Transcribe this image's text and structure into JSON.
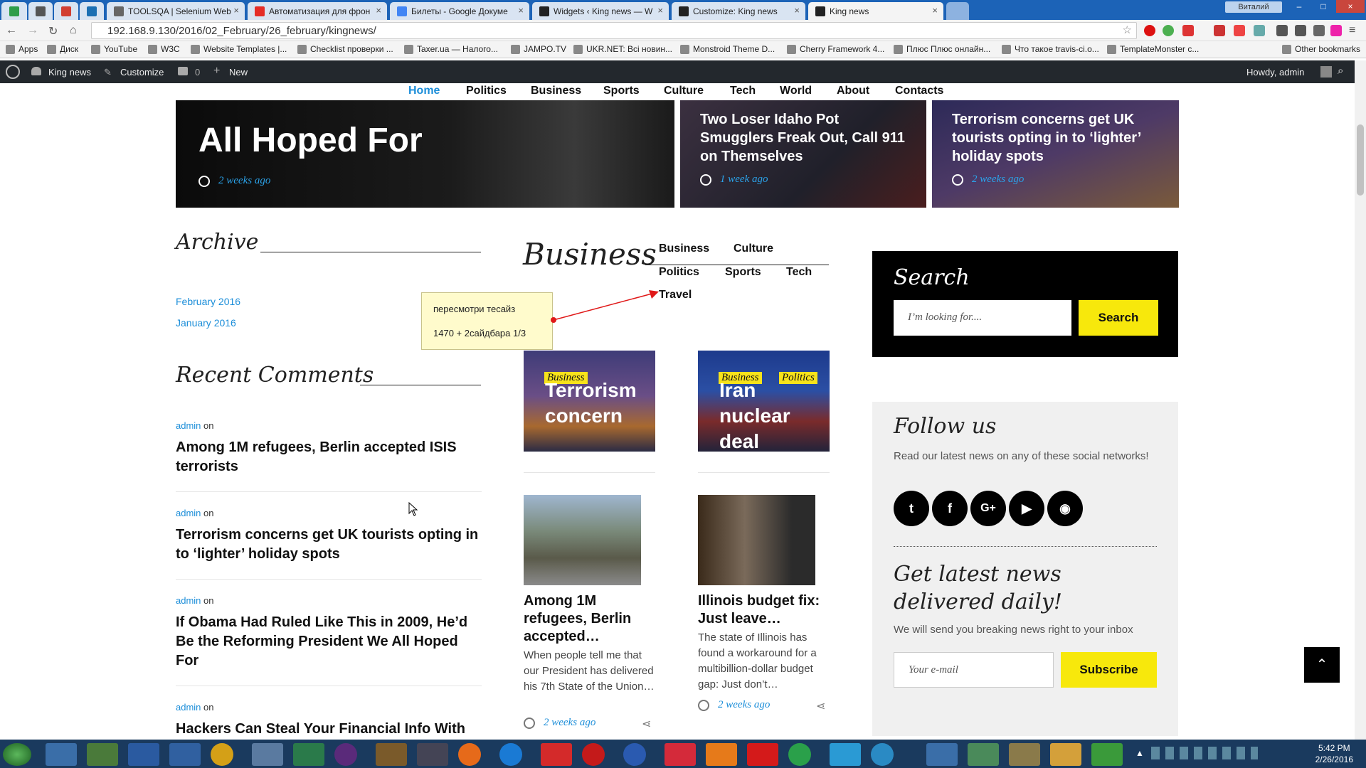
{
  "browser": {
    "tabs": [
      {
        "label": ""
      },
      {
        "label": ""
      },
      {
        "label": ""
      },
      {
        "label": ""
      },
      {
        "label": "TOOLSQA | Selenium Web"
      },
      {
        "label": "Автоматизация для фрон"
      },
      {
        "label": "Билеты - Google Докуме"
      },
      {
        "label": "Widgets ‹ King news — W"
      },
      {
        "label": "Customize: King news"
      },
      {
        "label": "King news"
      }
    ],
    "window_user": "Виталий",
    "url": "192.168.9.130/2016/02_February/26_february/kingnews/",
    "bookmarks": [
      "Apps",
      "Диск",
      "YouTube",
      "W3C",
      "Website Templates |...",
      "Checklist проверки ...",
      "Taxer.ua — Налого...",
      "JAMPO.TV",
      "UKR.NET: Всі новин...",
      "Monstroid Theme D...",
      "Cherry Framework 4...",
      "Плюс Плюс онлайн...",
      "Что такое travis-ci.o...",
      "TemplateMonster c...",
      "Other bookmarks"
    ]
  },
  "adminbar": {
    "site": "King news",
    "customize": "Customize",
    "comments": "0",
    "new": "New",
    "howdy": "Howdy, admin"
  },
  "nav": [
    "Home",
    "Politics",
    "Business",
    "Sports",
    "Culture",
    "Tech",
    "World",
    "About",
    "Contacts"
  ],
  "hero": [
    {
      "title": "All Hoped For",
      "date": "2 weeks ago"
    },
    {
      "title": "Two Loser Idaho Pot Smugglers Freak Out, Call 911 on Themselves",
      "date": "1 week ago"
    },
    {
      "title": "Terrorism concerns get UK tourists opting in to ‘lighter’ holiday spots",
      "date": "2 weeks ago"
    }
  ],
  "archive": {
    "title": "Archive",
    "items": [
      "February 2016",
      "January 2016"
    ]
  },
  "recent_comments": {
    "title": "Recent Comments",
    "items": [
      {
        "author": "admin",
        "on": "on",
        "post": "Among 1M refugees, Berlin accepted ISIS terrorists"
      },
      {
        "author": "admin",
        "on": "on",
        "post": "Terrorism concerns get UK tourists opting in to ‘lighter’ holiday spots"
      },
      {
        "author": "admin",
        "on": "on",
        "post": "If Obama Had Ruled Like This in 2009, He’d Be the Reforming President We All Hoped For"
      },
      {
        "author": "admin",
        "on": "on",
        "post": "Hackers Can Steal Your Financial Info With"
      }
    ]
  },
  "note": {
    "line1": "пересмотри тесайз",
    "line2": "1470 + 2сайдбара 1/3"
  },
  "business": {
    "title": "Business",
    "tabs": [
      "Business",
      "Culture",
      "Politics",
      "Sports",
      "Tech",
      "Travel"
    ],
    "cards": [
      {
        "badges": [
          "Business"
        ],
        "overlay": "Terrorism concern"
      },
      {
        "badges": [
          "Business",
          "Politics"
        ],
        "overlay": "Iran nuclear deal"
      }
    ],
    "posts": [
      {
        "title": "Among 1M refugees, Berlin accepted…",
        "excerpt": "When people tell me that our President has delivered his 7th State of the Union…",
        "date": "2 weeks ago"
      },
      {
        "title": "Illinois budget fix: Just leave…",
        "excerpt": "The state of Illinois has found a workaround for a multibillion-dollar budget gap: Just don’t…",
        "date": "2 weeks ago"
      }
    ]
  },
  "search": {
    "title": "Search",
    "placeholder": "I’m looking for....",
    "button": "Search"
  },
  "follow": {
    "title": "Follow us",
    "text": "Read our latest news on any of these social networks!",
    "icons": [
      "twitter-icon",
      "facebook-icon",
      "google-plus-icon",
      "youtube-icon",
      "rss-icon"
    ],
    "newsletter_title": "Get latest news delivered daily!",
    "newsletter_text": "We will send you breaking news right to your inbox",
    "email_placeholder": "Your e-mail",
    "subscribe": "Subscribe"
  },
  "taskbar": {
    "time": "5:42 PM",
    "date": "2/26/2016"
  },
  "colors": {
    "accent": "#1c8ed9",
    "yellow": "#f7e80c",
    "admin_bar": "#23282d",
    "taskbar": "#1a3a5e"
  }
}
